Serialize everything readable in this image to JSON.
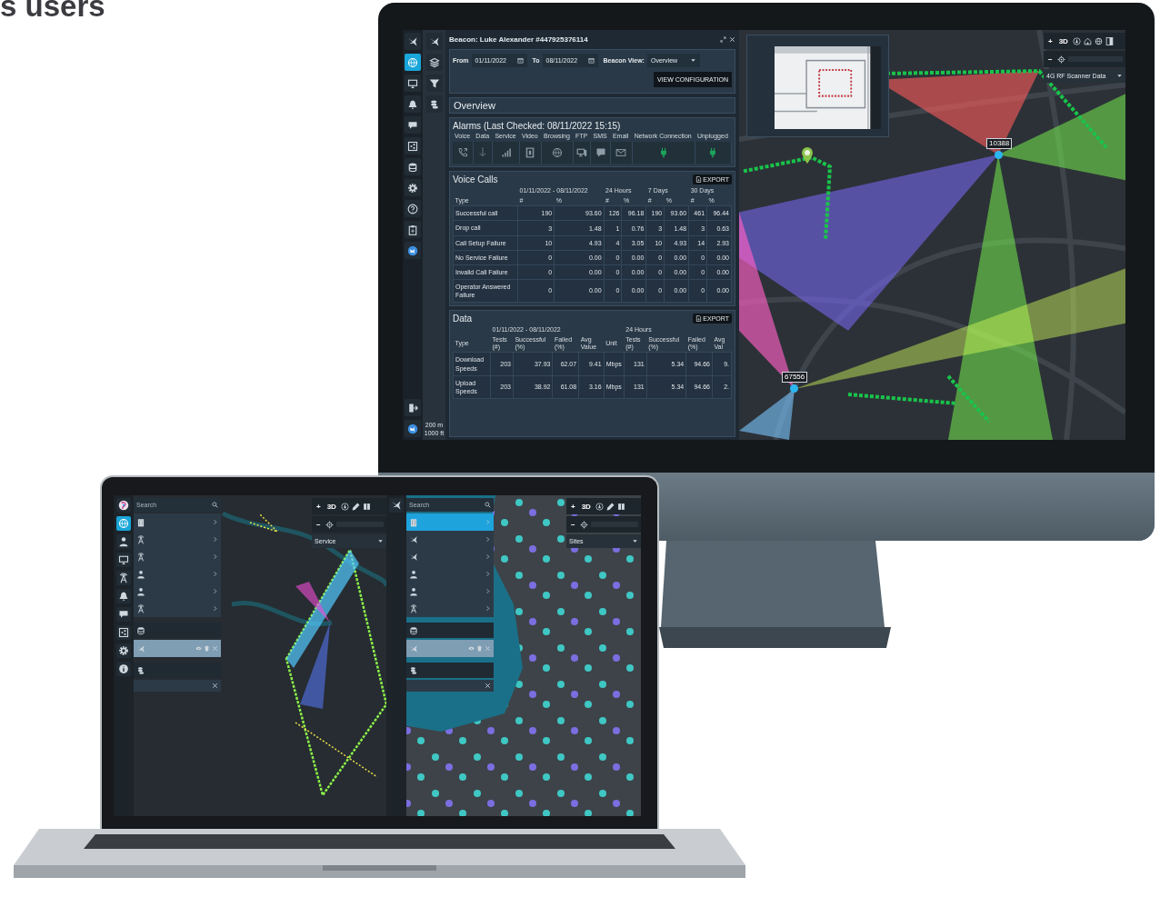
{
  "heading": "s users",
  "monitor": {
    "rail": [
      {
        "kind": "bird",
        "selected": false
      },
      {
        "kind": "globe",
        "selected": true
      },
      {
        "kind": "monitor",
        "selected": false
      },
      {
        "kind": "bell",
        "selected": false
      },
      {
        "kind": "chat",
        "selected": false
      },
      {
        "kind": "share",
        "selected": false
      },
      {
        "kind": "database",
        "selected": false
      },
      {
        "kind": "gear",
        "selected": false
      },
      {
        "kind": "help",
        "selected": false
      },
      {
        "kind": "clipboard",
        "selected": false
      },
      {
        "kind": "badge",
        "selected": false
      }
    ],
    "rail_bottom": [
      {
        "kind": "exit",
        "selected": false
      },
      {
        "kind": "badge",
        "selected": false
      }
    ],
    "tools": [
      {
        "kind": "bird"
      },
      {
        "kind": "layers"
      },
      {
        "kind": "filter"
      },
      {
        "kind": "coins"
      }
    ],
    "scale": [
      "200 m",
      "1000 ft"
    ],
    "beacon": {
      "title": "Beacon: Luke Alexander #447925376114",
      "from_label": "From",
      "from": "01/11/2022",
      "to_label": "To",
      "to": "08/11/2022",
      "view_label": "Beacon View:",
      "view": "Overview",
      "button": "VIEW CONFIGURATION"
    },
    "overview": "Overview",
    "alarms": {
      "title": "Alarms (Last Checked: 08/11/2022 15:15)",
      "items": [
        {
          "label": "Voice",
          "kind": "phone",
          "active": false
        },
        {
          "label": "Data",
          "kind": "download",
          "active": false
        },
        {
          "label": "Service",
          "kind": "signal",
          "active": false
        },
        {
          "label": "Video",
          "kind": "film",
          "active": false
        },
        {
          "label": "Browsing",
          "kind": "globe",
          "active": false
        },
        {
          "label": "FTP",
          "kind": "computer",
          "active": false
        },
        {
          "label": "SMS",
          "kind": "message",
          "active": false
        },
        {
          "label": "Email",
          "kind": "envelope",
          "active": false
        },
        {
          "label": "Network Connection",
          "kind": "plug",
          "active": true
        },
        {
          "label": "Unplugged",
          "kind": "plug",
          "active": true
        }
      ]
    },
    "voice_calls": {
      "title": "Voice Calls",
      "export": "EXPORT",
      "type_header": "Type",
      "periods": [
        {
          "label": "01/11/2022 - 08/11/2022",
          "columns": [
            "#",
            "%"
          ]
        },
        {
          "label": "24 Hours",
          "columns": [
            "#",
            "%"
          ]
        },
        {
          "label": "7 Days",
          "columns": [
            "#",
            "%"
          ]
        },
        {
          "label": "30 Days",
          "columns": [
            "#",
            "%"
          ]
        }
      ],
      "rows": [
        [
          "Successful call",
          "190",
          "93.60",
          "126",
          "96.18",
          "190",
          "93.60",
          "461",
          "96.44"
        ],
        [
          "Drop call",
          "3",
          "1.48",
          "1",
          "0.76",
          "3",
          "1.48",
          "3",
          "0.63"
        ],
        [
          "Call Setup Failure",
          "10",
          "4.93",
          "4",
          "3.05",
          "10",
          "4.93",
          "14",
          "2.93"
        ],
        [
          "No Service Failure",
          "0",
          "0.00",
          "0",
          "0.00",
          "0",
          "0.00",
          "0",
          "0.00"
        ],
        [
          "Invalid Call Failure",
          "0",
          "0.00",
          "0",
          "0.00",
          "0",
          "0.00",
          "0",
          "0.00"
        ],
        [
          "Operator Answered Failure",
          "0",
          "0.00",
          "0",
          "0.00",
          "0",
          "0.00",
          "0",
          "0.00"
        ]
      ]
    },
    "data": {
      "title": "Data",
      "export": "EXPORT",
      "type_header": "Type",
      "periods": [
        {
          "label": "01/11/2022 - 08/11/2022",
          "columns": [
            "Tests (#)",
            "Successful (%)",
            "Failed (%)",
            "Avg Value",
            "Unit"
          ]
        },
        {
          "label": "24 Hours",
          "columns": [
            "Tests (#)",
            "Successful (%)",
            "Failed (%)",
            "Avg Val"
          ]
        }
      ],
      "rows": [
        [
          "Download Speeds",
          "203",
          "37.93",
          "62.07",
          "9.41",
          "Mbps",
          "131",
          "5.34",
          "94.66",
          "9."
        ],
        [
          "Upload Speeds",
          "203",
          "38.92",
          "61.08",
          "3.16",
          "Mbps",
          "131",
          "5.34",
          "94.66",
          "2."
        ]
      ]
    },
    "map": {
      "controls": {
        "zoom_in": "+",
        "mode": "3D",
        "zoom_out": "−"
      },
      "layer": "4G RF Scanner Data",
      "sites": [
        {
          "label": "10388"
        },
        {
          "label": "67556"
        }
      ]
    }
  },
  "laptop": {
    "screens": [
      {
        "rail": [
          {
            "kind": "logo",
            "selected": false
          },
          {
            "kind": "globe",
            "selected": true
          },
          {
            "kind": "person",
            "selected": false
          },
          {
            "kind": "monitor",
            "selected": false
          },
          {
            "kind": "tower",
            "selected": false
          },
          {
            "kind": "bell",
            "selected": false
          },
          {
            "kind": "chat",
            "selected": false
          },
          {
            "kind": "share",
            "selected": false
          },
          {
            "kind": "gear",
            "selected": false
          },
          {
            "kind": "info",
            "selected": false
          }
        ],
        "search": {
          "placeholder": "Search"
        },
        "menu": [
          {
            "kind": "building",
            "selected": false
          },
          {
            "kind": "tower",
            "selected": false
          },
          {
            "kind": "tower",
            "selected": false
          },
          {
            "kind": "person",
            "selected": false
          },
          {
            "kind": "person",
            "selected": false
          },
          {
            "kind": "tower",
            "selected": false
          }
        ],
        "layers": [
          {
            "kind": "bird",
            "selected": true
          }
        ],
        "controls": {
          "zoom_in": "+",
          "mode": "3D",
          "zoom_out": "−"
        },
        "dropdown": "Service"
      },
      {
        "rail": [
          {
            "kind": "bird",
            "selected": false
          }
        ],
        "search": {
          "placeholder": "Search"
        },
        "menu": [
          {
            "kind": "building",
            "selected": true
          },
          {
            "kind": "bird",
            "selected": false
          },
          {
            "kind": "bird",
            "selected": false
          },
          {
            "kind": "person",
            "selected": false
          },
          {
            "kind": "person",
            "selected": false
          },
          {
            "kind": "tower",
            "selected": false
          }
        ],
        "layers": [
          {
            "kind": "bird",
            "selected": true
          }
        ],
        "controls": {
          "zoom_in": "+",
          "mode": "3D",
          "zoom_out": "−"
        },
        "dropdown": "Sites"
      }
    ]
  }
}
